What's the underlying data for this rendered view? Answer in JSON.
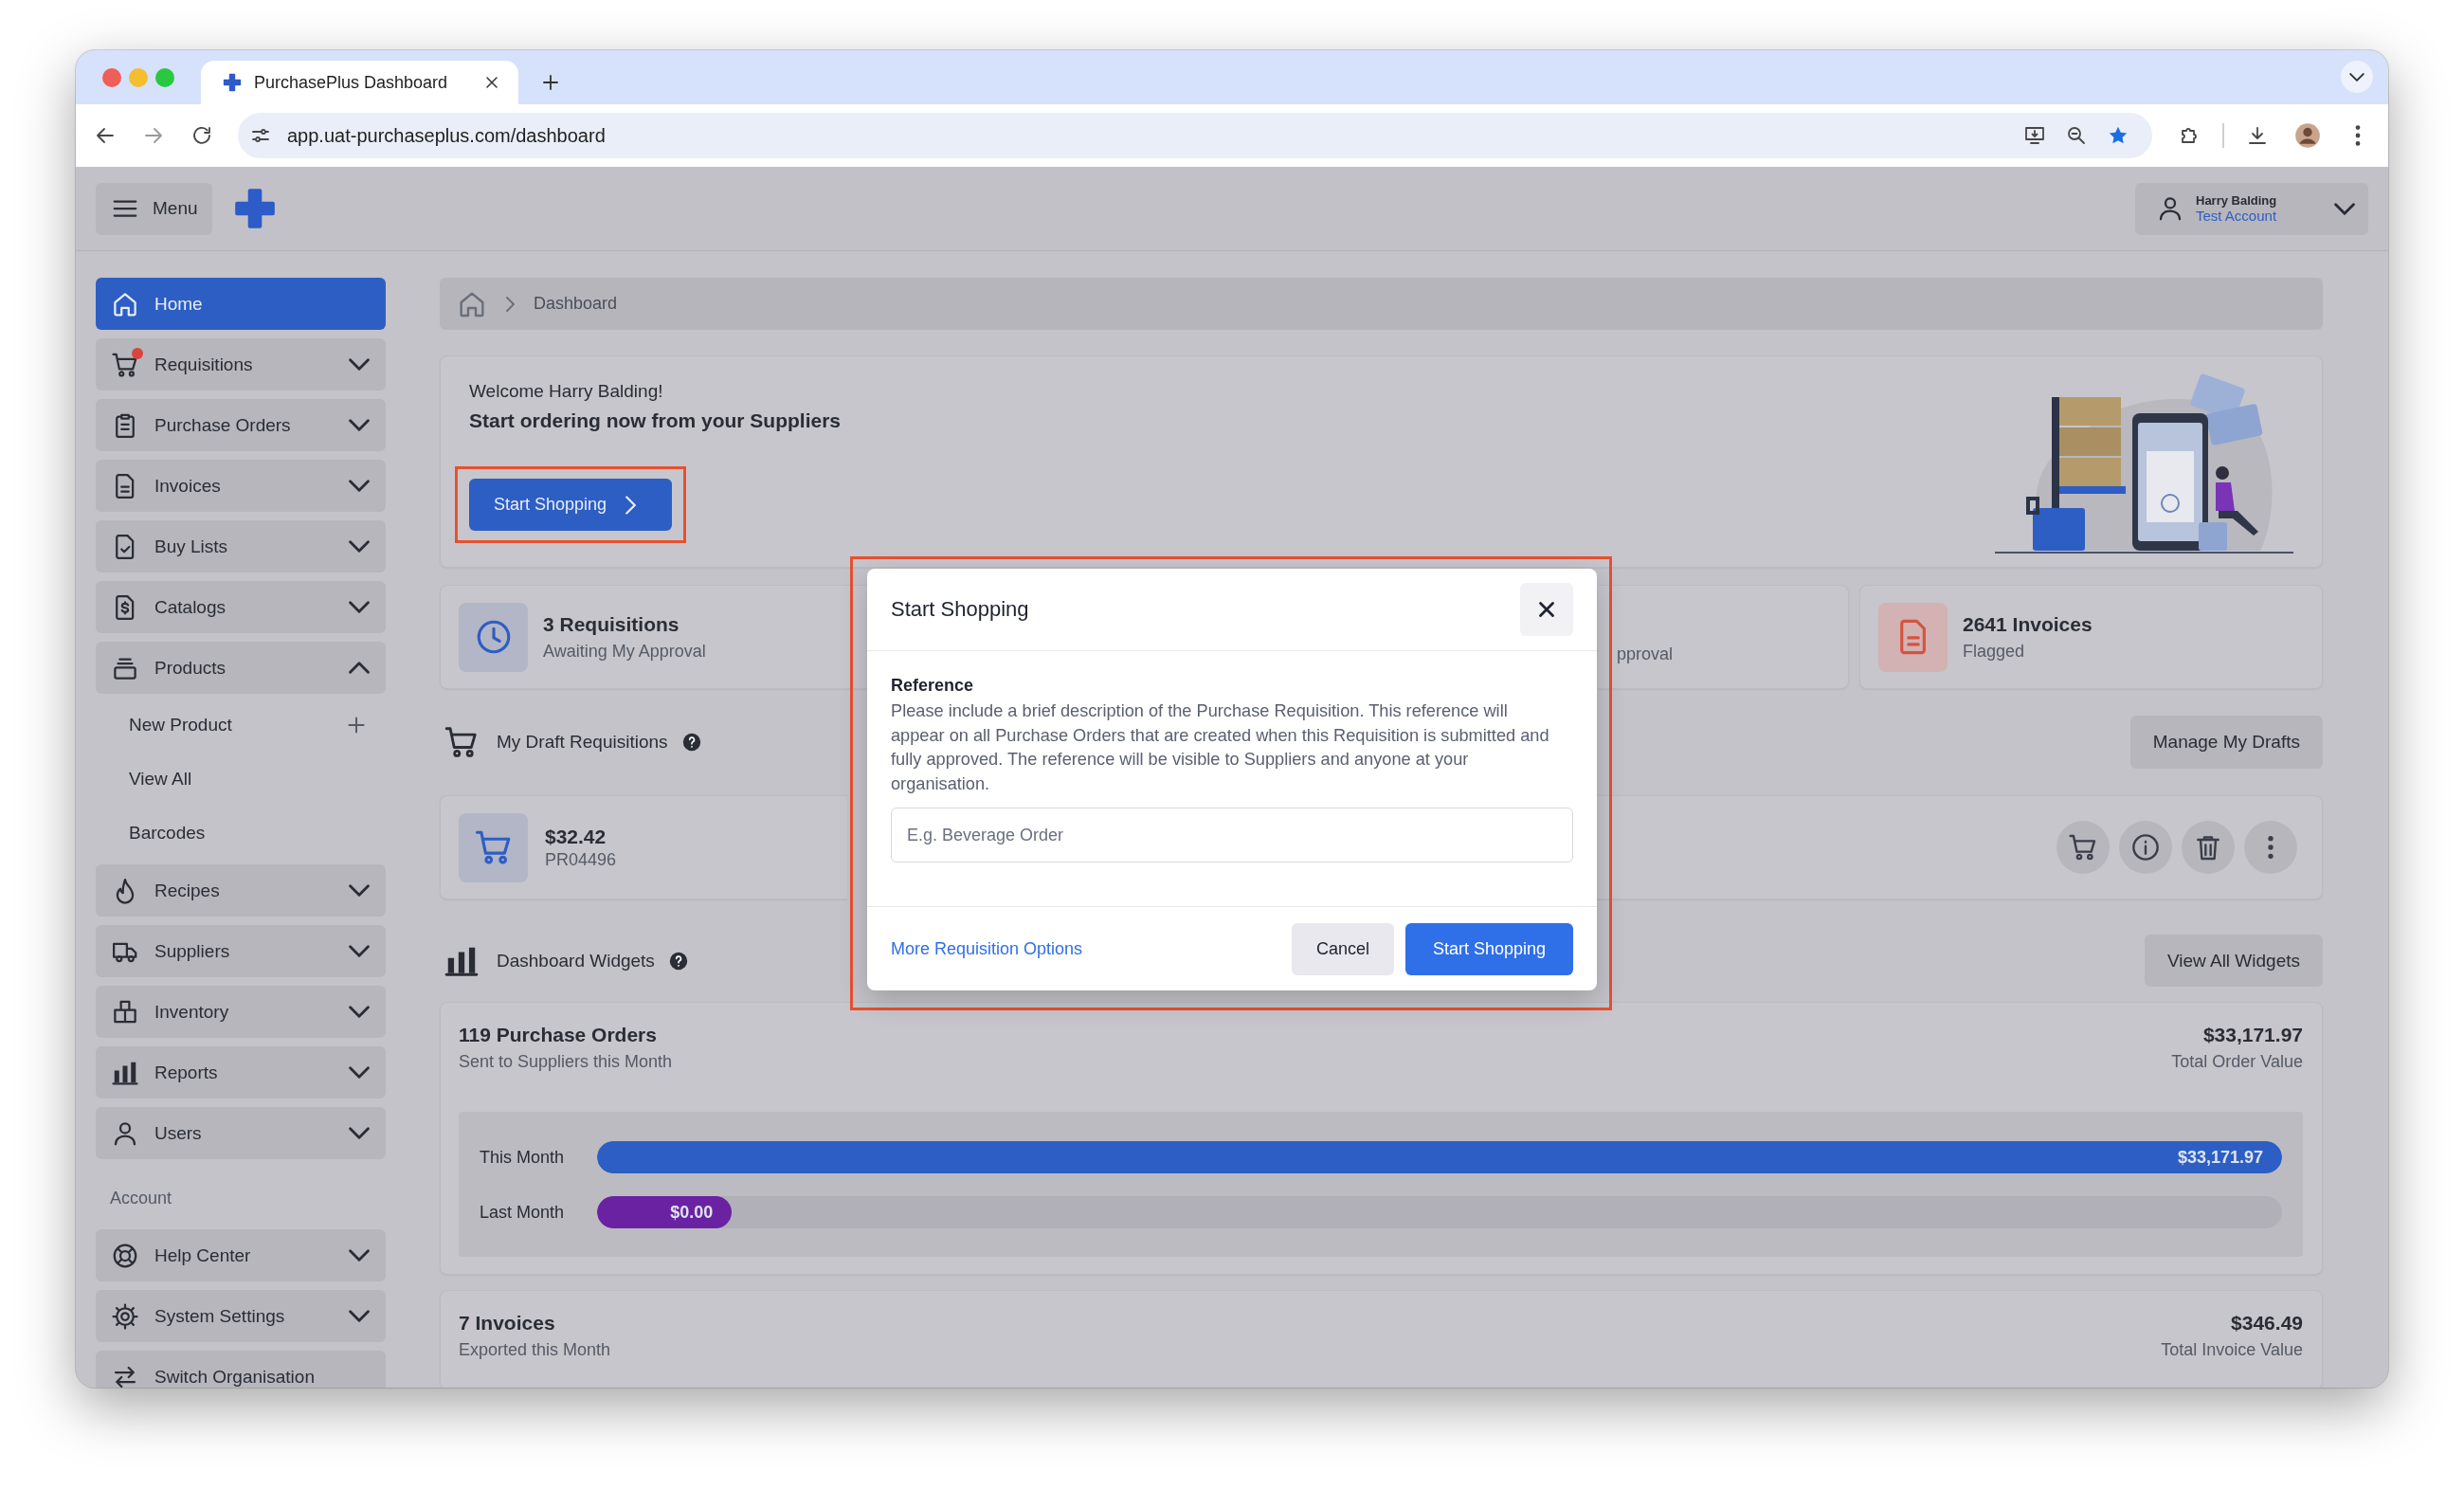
{
  "browser": {
    "tab_title": "PurchasePlus Dashboard",
    "url": "app.uat-purchaseplus.com/dashboard"
  },
  "header": {
    "menu_label": "Menu",
    "user_name": "Harry Balding",
    "account": "Test Account"
  },
  "sidebar": {
    "sections": [
      {
        "items": [
          {
            "label": "Home",
            "selected": true,
            "alert": false
          },
          {
            "label": "Requisitions",
            "selected": false,
            "alert": true,
            "expanded": false
          },
          {
            "label": "Purchase Orders",
            "selected": false,
            "alert": false,
            "expanded": false
          },
          {
            "label": "Invoices",
            "selected": false,
            "alert": false,
            "expanded": false
          },
          {
            "label": "Buy Lists",
            "selected": false,
            "alert": false,
            "expanded": false
          },
          {
            "label": "Catalogs",
            "selected": false,
            "alert": false,
            "expanded": false
          },
          {
            "label": "Products",
            "selected": false,
            "alert": false,
            "expanded": true,
            "children": [
              {
                "label": "New Product",
                "kind": "add"
              },
              {
                "label": "View All",
                "kind": "link"
              },
              {
                "label": "Barcodes",
                "kind": "link"
              }
            ]
          },
          {
            "label": "Recipes",
            "selected": false,
            "alert": false,
            "expanded": false
          },
          {
            "label": "Suppliers",
            "selected": false,
            "alert": false,
            "expanded": false
          },
          {
            "label": "Inventory",
            "selected": false,
            "alert": false,
            "expanded": false
          },
          {
            "label": "Reports",
            "selected": false,
            "alert": false,
            "expanded": false
          },
          {
            "label": "Users",
            "selected": false,
            "alert": false,
            "expanded": false
          }
        ]
      },
      {
        "label": "Account",
        "items": [
          {
            "label": "Help Center",
            "selected": false,
            "alert": false,
            "expanded": false
          },
          {
            "label": "System Settings",
            "selected": false,
            "alert": false,
            "expanded": false
          },
          {
            "label": "Switch Organisation",
            "selected": false,
            "alert": false
          }
        ]
      }
    ]
  },
  "breadcrumb": [
    "Dashboard"
  ],
  "welcome": {
    "greeting": "Welcome Harry Balding!",
    "headline": "Start ordering now from your Suppliers",
    "button": "Start Shopping"
  },
  "stats": [
    {
      "kind": "full",
      "title": "3 Requisitions",
      "subtitle": "Awaiting My Approval"
    },
    {
      "kind": "hidden"
    },
    {
      "kind": "partial",
      "subtitle": "pproval"
    },
    {
      "kind": "full",
      "title": "2641 Invoices",
      "subtitle": "Flagged"
    }
  ],
  "drafts": {
    "title": "My Draft Requisitions",
    "manage": "Manage My Drafts",
    "items": [
      {
        "amount": "$32.42",
        "number": "PR04496"
      }
    ]
  },
  "widgets": {
    "title": "Dashboard Widgets",
    "view_all": "View All Widgets",
    "cards": [
      {
        "title": "119 Purchase Orders",
        "subtitle": "Sent to Suppliers this Month",
        "value": "$33,171.97",
        "value_label": "Total Order Value",
        "bars": [
          {
            "label": "This Month",
            "value": "$33,171.97",
            "level": 1.0,
            "color": "#2d5ec4"
          },
          {
            "label": "Last Month",
            "value": "$0.00",
            "level": 0.08,
            "color": "#6a22a3"
          }
        ]
      },
      {
        "title": "7 Invoices",
        "subtitle": "Exported this Month",
        "value": "$346.49",
        "value_label": "Total Invoice Value"
      }
    ]
  },
  "modal": {
    "title": "Start Shopping",
    "field_label": "Reference",
    "help": "Please include a brief description of the Purchase Requisition. This reference will appear on all Purchase Orders that are created when this Requisition is submitted and fully approved. The reference will be visible to Suppliers and anyone at your organisation.",
    "placeholder": "E.g. Beverage Order",
    "link": "More Requisition Options",
    "cancel": "Cancel",
    "submit": "Start Shopping"
  }
}
